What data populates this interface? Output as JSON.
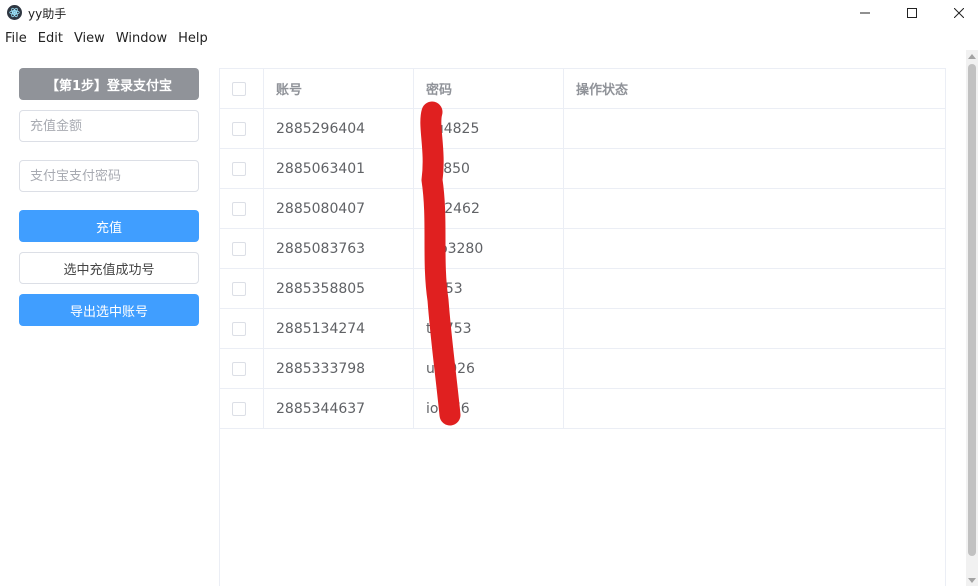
{
  "window": {
    "title": "yy助手"
  },
  "menu": [
    "File",
    "Edit",
    "View",
    "Window",
    "Help"
  ],
  "sidebar": {
    "step1_button": "【第1步】登录支付宝",
    "amount_placeholder": "充值金额",
    "password_placeholder": "支付宝支付密码",
    "recharge_button": "充值",
    "select_success_button": "选中充值成功号",
    "export_button": "导出选中账号"
  },
  "table": {
    "columns": [
      "",
      "账号",
      "密码",
      "操作状态"
    ],
    "rows": [
      {
        "account": "2885296404",
        "password": "nu4825",
        "status": ""
      },
      {
        "account": "2885063401",
        "password": "y4850",
        "status": ""
      },
      {
        "account": "2885080407",
        "password": "t x2462",
        "status": ""
      },
      {
        "account": "2885083763",
        "password": "v b3280",
        "status": ""
      },
      {
        "account": "2885358805",
        "password": "t 553",
        "status": ""
      },
      {
        "account": "2885134274",
        "password": "t 2753",
        "status": ""
      },
      {
        "account": "2885333798",
        "password": "u 4026",
        "status": ""
      },
      {
        "account": "2885344637",
        "password": "io 476",
        "status": ""
      }
    ]
  },
  "colors": {
    "primary": "#409eff",
    "gray_button": "#909399",
    "redaction": "#e02020"
  }
}
